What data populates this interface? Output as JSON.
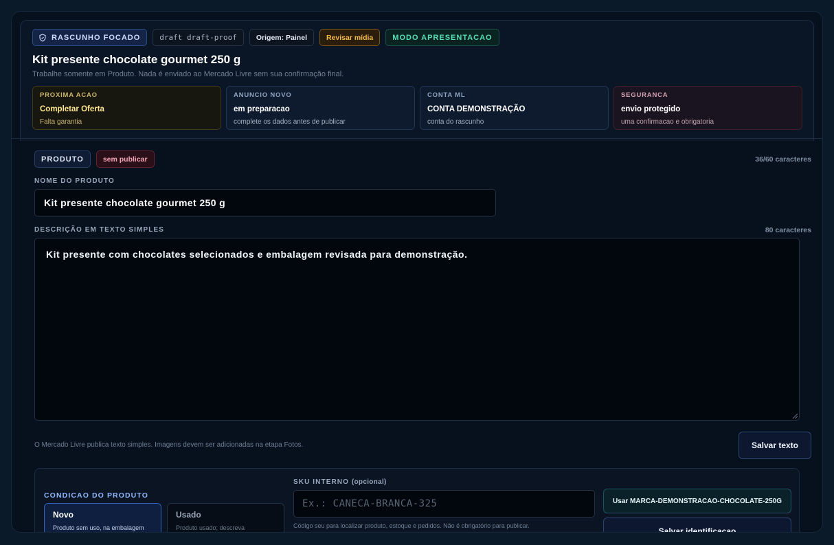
{
  "header": {
    "chips": {
      "draft_label": "RASCUNHO FOCADO",
      "code": "draft draft-proof",
      "origin": "Origem: Painel",
      "media": "Revisar mídia",
      "mode": "MODO APRESENTACAO"
    },
    "title": "Kit presente chocolate gourmet 250 g",
    "subtitle": "Trabalhe somente em Produto. Nada é enviado ao Mercado Livre sem sua confirmação final."
  },
  "status_cards": [
    {
      "key": "PROXIMA ACAO",
      "value": "Completar Oferta",
      "detail": "Falta garantia"
    },
    {
      "key": "ANUNCIO NOVO",
      "value": "em preparacao",
      "detail": "complete os dados antes de publicar"
    },
    {
      "key": "CONTA ML",
      "value": "CONTA DEMONSTRAÇÃO",
      "detail": "conta do rascunho"
    },
    {
      "key": "SEGURANCA",
      "value": "envio protegido",
      "detail": "uma confirmacao e obrigatoria"
    }
  ],
  "product": {
    "section_chip": "PRODUTO",
    "status_chip": "sem publicar",
    "name_count": "36/60 caracteres",
    "name_label": "NOME DO PRODUTO",
    "name_value": "Kit presente chocolate gourmet 250 g",
    "desc_label": "DESCRIÇÃO EM TEXTO SIMPLES",
    "desc_count": "80 caracteres",
    "desc_value": "Kit presente com chocolates selecionados e embalagem revisada para demonstração.",
    "hint": "O Mercado Livre publica texto simples. Imagens devem ser adicionadas na etapa Fotos.",
    "save_label": "Salvar texto"
  },
  "identification": {
    "condition_label": "CONDICAO DO PRODUTO",
    "options": [
      {
        "title": "Novo",
        "desc": "Produto sem uso, na embalagem ou apresentacao informada."
      },
      {
        "title": "Usado",
        "desc": "Produto usado; descreva claramente o estado real."
      }
    ],
    "selected": "Novo",
    "sku_label": "SKU INTERNO",
    "sku_optional": "(opcional)",
    "sku_placeholder": "Ex.: CANECA-BRANCA-325",
    "sku_hint": "Código seu para localizar produto, estoque e pedidos. Não é obrigatório para publicar.",
    "use_brand_label": "Usar MARCA-DEMONSTRACAO-CHOCOLATE-250G",
    "save_label": "Salvar identificacao"
  },
  "colors": {
    "background": "#0b1a28",
    "accent_blue": "#8fb8ff",
    "warning": "#f5b94a",
    "success": "#55e0b5",
    "danger": "#f4a3b4"
  }
}
